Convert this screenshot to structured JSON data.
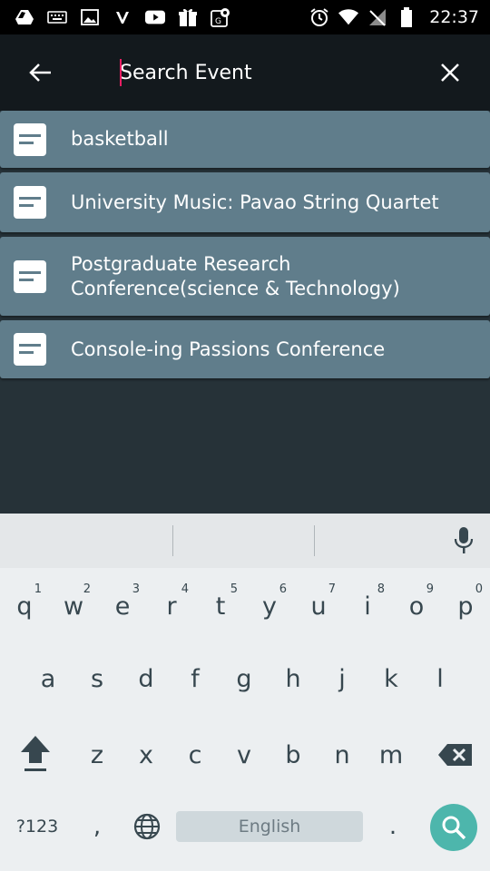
{
  "status_bar": {
    "time": "22:37",
    "left_icons": [
      "drive-icon",
      "keyboard-icon",
      "image-icon",
      "v-icon",
      "youtube-icon",
      "gift-icon",
      "maps-icon"
    ],
    "right_icons": [
      "alarm-icon",
      "wifi-icon",
      "no-signal-icon",
      "battery-icon"
    ]
  },
  "toolbar": {
    "search_placeholder": "Search Event",
    "search_value": ""
  },
  "results": [
    {
      "label": "basketball"
    },
    {
      "label": "University Music: Pavao String Quartet"
    },
    {
      "label": "Postgraduate Research Conference(science & Technology)"
    },
    {
      "label": "Console-ing Passions Conference"
    }
  ],
  "keyboard": {
    "row1": [
      {
        "key": "q",
        "hint": "1"
      },
      {
        "key": "w",
        "hint": "2"
      },
      {
        "key": "e",
        "hint": "3"
      },
      {
        "key": "r",
        "hint": "4"
      },
      {
        "key": "t",
        "hint": "5"
      },
      {
        "key": "y",
        "hint": "6"
      },
      {
        "key": "u",
        "hint": "7"
      },
      {
        "key": "i",
        "hint": "8"
      },
      {
        "key": "o",
        "hint": "9"
      },
      {
        "key": "p",
        "hint": "0"
      }
    ],
    "row2": [
      "a",
      "s",
      "d",
      "f",
      "g",
      "h",
      "j",
      "k",
      "l"
    ],
    "row3": [
      "z",
      "x",
      "c",
      "v",
      "b",
      "n",
      "m"
    ],
    "symbols_label": "?123",
    "comma_label": ",",
    "space_label": "English",
    "period_label": "."
  },
  "colors": {
    "background": "#263238",
    "toolbar": "#13191d",
    "card": "#607d8b",
    "accent": "#e91e63",
    "fab": "#4db6ac"
  }
}
